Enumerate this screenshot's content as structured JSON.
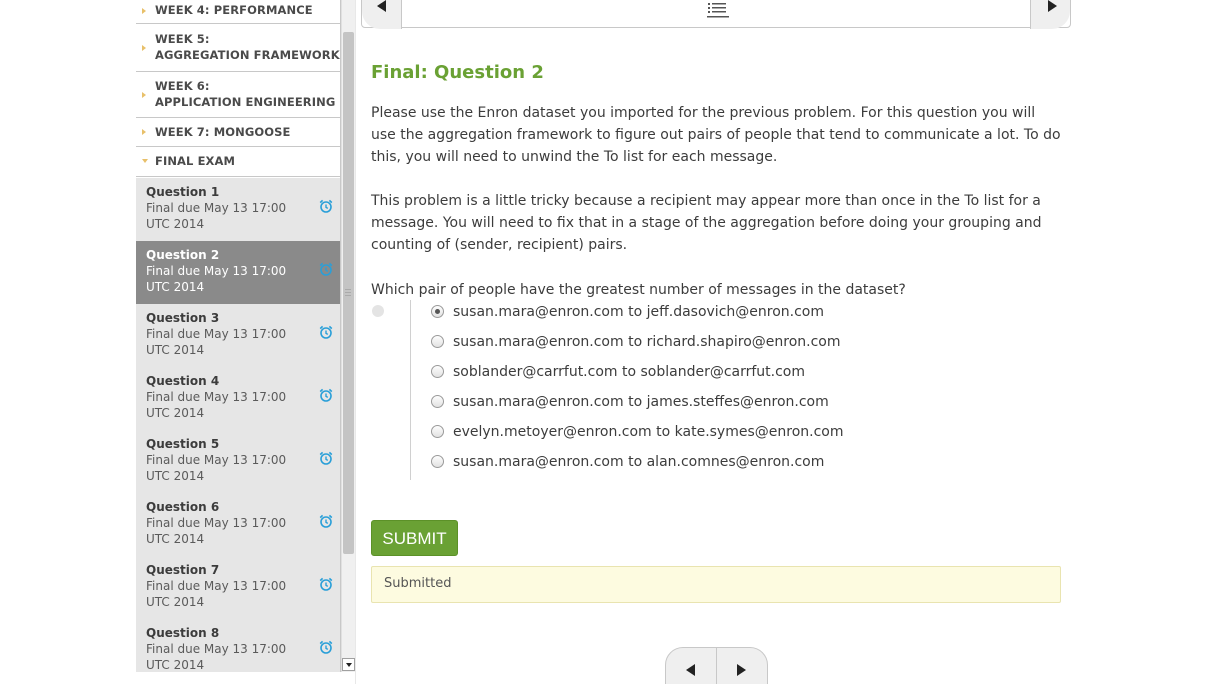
{
  "sidebar": {
    "chapters": [
      {
        "label_lines": [
          "WEEK 4: PERFORMANCE"
        ],
        "expanded": false
      },
      {
        "label_lines": [
          "WEEK 5:",
          "AGGREGATION FRAMEWORK"
        ],
        "expanded": false
      },
      {
        "label_lines": [
          "WEEK 6:",
          "APPLICATION ENGINEERING"
        ],
        "expanded": false
      },
      {
        "label_lines": [
          "WEEK 7: MONGOOSE"
        ],
        "expanded": false
      },
      {
        "label_lines": [
          "FINAL EXAM"
        ],
        "expanded": true
      }
    ],
    "questions": [
      {
        "title": "Question 1",
        "due": "Final due May 13 17:00 UTC 2014",
        "active": false
      },
      {
        "title": "Question 2",
        "due": "Final due May 13 17:00 UTC 2014",
        "active": true
      },
      {
        "title": "Question 3",
        "due": "Final due May 13 17:00 UTC 2014",
        "active": false
      },
      {
        "title": "Question 4",
        "due": "Final due May 13 17:00 UTC 2014",
        "active": false
      },
      {
        "title": "Question 5",
        "due": "Final due May 13 17:00 UTC 2014",
        "active": false
      },
      {
        "title": "Question 6",
        "due": "Final due May 13 17:00 UTC 2014",
        "active": false
      },
      {
        "title": "Question 7",
        "due": "Final due May 13 17:00 UTC 2014",
        "active": false
      },
      {
        "title": "Question 8",
        "due": "Final due May 13 17:00 UTC 2014",
        "active": false
      }
    ]
  },
  "problem": {
    "title": "Final: Question 2",
    "paragraph1": "Please use the Enron dataset you imported for the previous problem. For this question you will use the aggregation framework to figure out pairs of people that tend to communicate a lot. To do this, you will need to unwind the To list for each message.",
    "paragraph2": "This problem is a little tricky because a recipient may appear more than once in the To list for a message. You will need to fix that in a stage of the aggregation before doing your grouping and counting of (sender, recipient) pairs.",
    "question": "Which pair of people have the greatest number of messages in the dataset?",
    "choices": [
      {
        "text": "susan.mara@enron.com to jeff.dasovich@enron.com",
        "checked": true
      },
      {
        "text": "susan.mara@enron.com to richard.shapiro@enron.com",
        "checked": false
      },
      {
        "text": "soblander@carrfut.com to soblander@carrfut.com",
        "checked": false
      },
      {
        "text": "susan.mara@enron.com to james.steffes@enron.com",
        "checked": false
      },
      {
        "text": "evelyn.metoyer@enron.com to kate.symes@enron.com",
        "checked": false
      },
      {
        "text": "susan.mara@enron.com to alan.comnes@enron.com",
        "checked": false
      }
    ],
    "submit_label": "SUBMIT",
    "status_message": "Submitted"
  },
  "icons": {
    "chapter_arrow": "triangle-right-icon",
    "due_clock": "alarm-clock-icon",
    "sequence_list": "list-icon",
    "prev": "chevron-left-icon",
    "next": "chevron-right-icon"
  },
  "colors": {
    "accent_green": "#6aa134",
    "clock_blue": "#2a9fd8",
    "active_item": "#8a8a8a",
    "inactive_item": "#e6e6e6",
    "notice_bg": "#fdfbe0"
  }
}
